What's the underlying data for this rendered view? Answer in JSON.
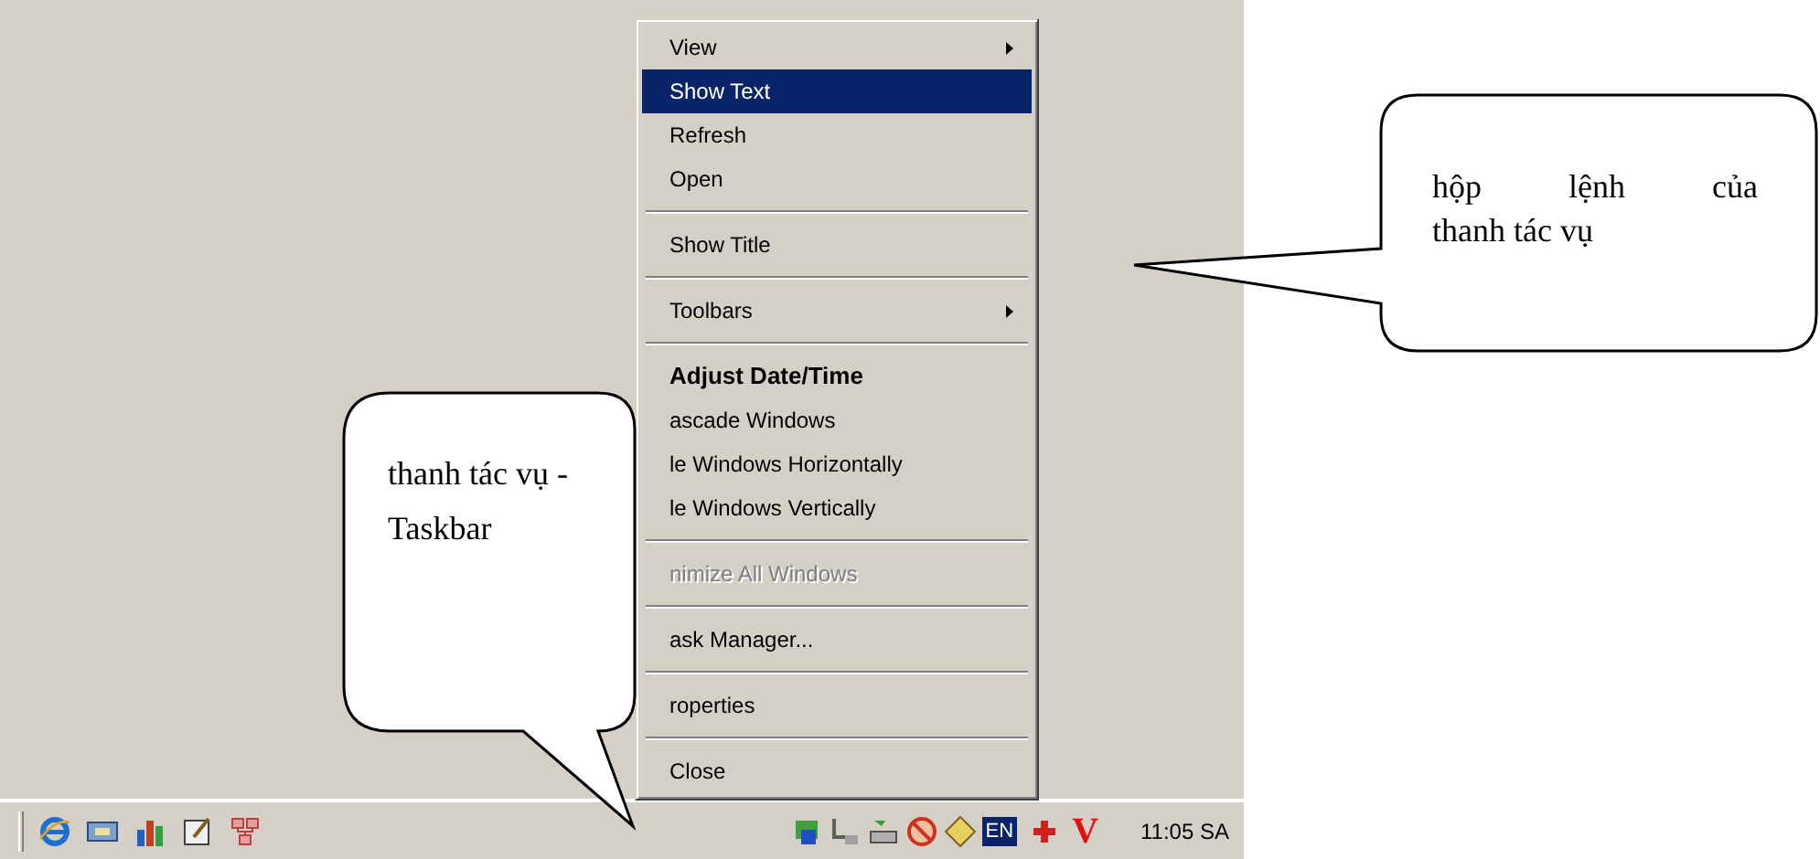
{
  "context_menu": {
    "items": [
      {
        "kind": "item",
        "label": "View",
        "submenu": true,
        "selected": false,
        "disabled": false,
        "default": false
      },
      {
        "kind": "item",
        "label": "Show Text",
        "submenu": false,
        "selected": true,
        "disabled": false,
        "default": false
      },
      {
        "kind": "item",
        "label": "Refresh",
        "submenu": false,
        "selected": false,
        "disabled": false,
        "default": false
      },
      {
        "kind": "item",
        "label": "Open",
        "submenu": false,
        "selected": false,
        "disabled": false,
        "default": false
      },
      {
        "kind": "separator"
      },
      {
        "kind": "item",
        "label": "Show Title",
        "submenu": false,
        "selected": false,
        "disabled": false,
        "default": false
      },
      {
        "kind": "separator"
      },
      {
        "kind": "item",
        "label": "Toolbars",
        "submenu": true,
        "selected": false,
        "disabled": false,
        "default": false
      },
      {
        "kind": "separator"
      },
      {
        "kind": "item",
        "label": "Adjust Date/Time",
        "submenu": false,
        "selected": false,
        "disabled": false,
        "default": true
      },
      {
        "kind": "item",
        "label": "ascade Windows",
        "submenu": false,
        "selected": false,
        "disabled": false,
        "default": false
      },
      {
        "kind": "item",
        "label": "le Windows Horizontally",
        "submenu": false,
        "selected": false,
        "disabled": false,
        "default": false
      },
      {
        "kind": "item",
        "label": "le Windows Vertically",
        "submenu": false,
        "selected": false,
        "disabled": false,
        "default": false
      },
      {
        "kind": "separator"
      },
      {
        "kind": "item",
        "label": "nimize All Windows",
        "submenu": false,
        "selected": false,
        "disabled": true,
        "default": false
      },
      {
        "kind": "separator"
      },
      {
        "kind": "item",
        "label": "ask Manager...",
        "submenu": false,
        "selected": false,
        "disabled": false,
        "default": false
      },
      {
        "kind": "separator"
      },
      {
        "kind": "item",
        "label": "roperties",
        "submenu": false,
        "selected": false,
        "disabled": false,
        "default": false
      },
      {
        "kind": "separator"
      },
      {
        "kind": "item",
        "label": "Close",
        "submenu": false,
        "selected": false,
        "disabled": false,
        "default": false
      }
    ]
  },
  "taskbar": {
    "language": "EN",
    "input_mark": "V",
    "clock": "11:05 SA"
  },
  "callouts": [
    {
      "lines": [
        "thanh tác vụ -",
        "Taskbar"
      ]
    },
    {
      "lines": [
        "hộp lệnh của",
        "thanh tác vụ"
      ]
    }
  ]
}
